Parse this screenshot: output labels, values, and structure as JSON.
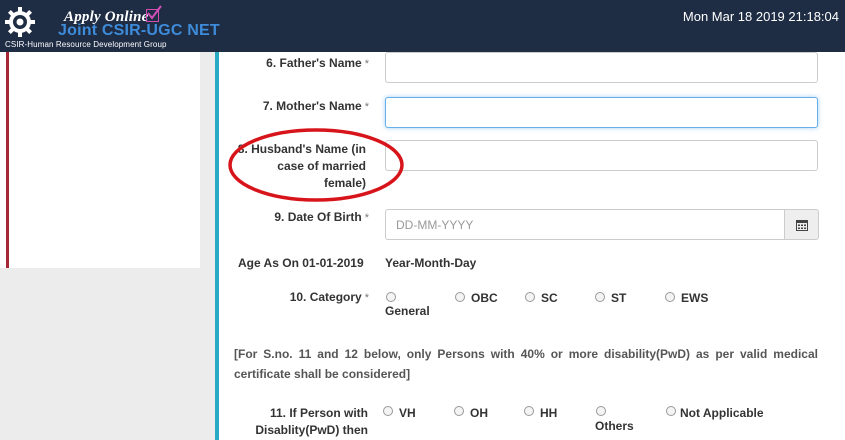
{
  "header": {
    "logo_icon": "csir-gear-logo-icon",
    "apply_text": "Apply Online",
    "program_name": "Joint CSIR-UGC NET",
    "org_name": "CSIR-Human Resource Development Group",
    "datetime": "Mon Mar 18 2019 21:18:04",
    "colors": {
      "header_bg": "#1e2c44",
      "program_blue": "#3d8bd9",
      "checkbox_pink": "#d24fb8"
    }
  },
  "form": {
    "father": {
      "label": "6. Father's Name",
      "value": ""
    },
    "mother": {
      "label": "7. Mother's Name",
      "value": ""
    },
    "husband": {
      "label_line1": "8. Husband's Name (in",
      "label_line2": "case of married",
      "label_line3": "female)",
      "value": ""
    },
    "dob": {
      "label": "9. Date Of Birth",
      "placeholder": "DD-MM-YYYY",
      "icon": "calendar-icon"
    },
    "age": {
      "label": "Age As On 01-01-2019",
      "value": "Year-Month-Day"
    },
    "category": {
      "label": "10. Category",
      "options": [
        "General",
        "OBC",
        "SC",
        "ST",
        "EWS"
      ]
    },
    "note": "[For S.no. 11 and 12 below, only Persons with 40% or more disability(PwD) as per valid medical certificate shall be considered]",
    "pwd": {
      "label_line1": "11. If Person with",
      "label_line2": "Disablity(PwD) then",
      "options": [
        "VH",
        "OH",
        "HH",
        "Others",
        "Not Applicable"
      ]
    },
    "required_mark": "*"
  },
  "colors": {
    "main_accent": "#2aa9c4",
    "left_accent": "#a52834",
    "annotation_red": "#d8141b",
    "focus_border": "#66afe9"
  }
}
